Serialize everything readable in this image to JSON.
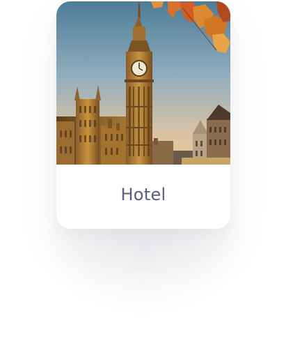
{
  "card": {
    "title": "Hotel",
    "image_subject": "big-ben-clock-tower-photo",
    "title_color": "#5a5d7d"
  }
}
